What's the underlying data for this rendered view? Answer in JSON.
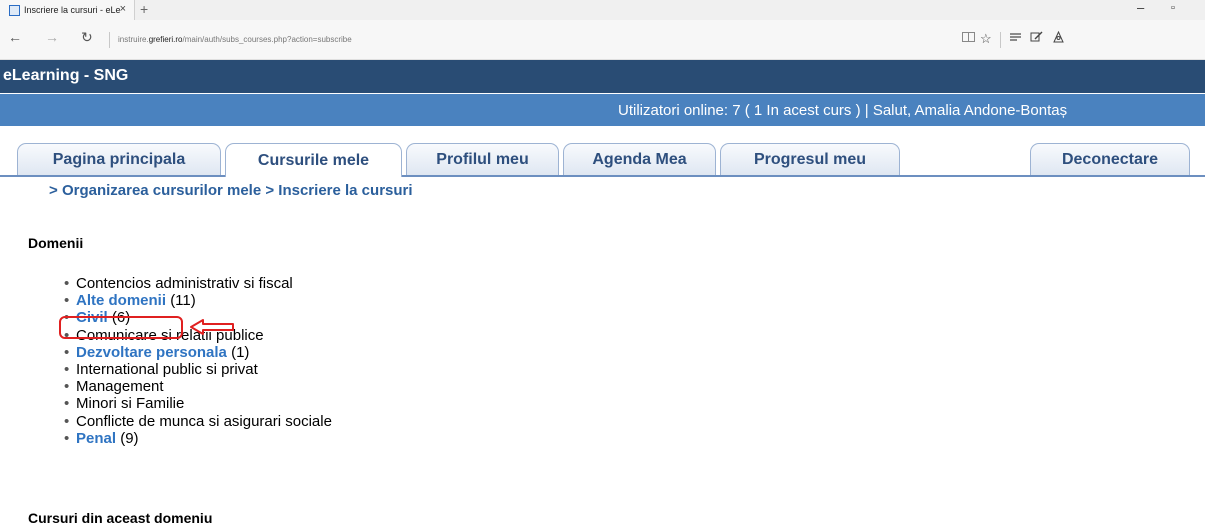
{
  "browser": {
    "tab_title": "Inscriere la cursuri - eLe",
    "tab_close": "×",
    "new_tab": "+",
    "address_prefix": "instruire.",
    "address_domain": "grefieri.ro",
    "address_path": "/main/auth/subs_courses.php?action=subscribe",
    "back": "←",
    "forward": "→",
    "refresh": "↻",
    "window_minimize": "–",
    "window_maximize": "▫",
    "icons": [
      "reading-view-icon",
      "favorites-icon",
      "hub-icon",
      "web-note-icon",
      "share-icon"
    ]
  },
  "site": {
    "title": "eLearning - SNG",
    "info_text": "Utilizatori online:  7  ( 1 In acest curs  ) | Salut, Amalia Andone-Bontaș"
  },
  "tabs": [
    {
      "label": "Pagina principala",
      "active": false
    },
    {
      "label": "Cursurile mele",
      "active": true
    },
    {
      "label": "Profilul meu",
      "active": false
    },
    {
      "label": "Agenda Mea",
      "active": false
    },
    {
      "label": "Progresul meu",
      "active": false
    },
    {
      "label": "Deconectare",
      "active": false
    }
  ],
  "breadcrumb": {
    "sep": ">",
    "items": [
      "Organizarea cursurilor mele",
      "Inscriere la cursuri"
    ]
  },
  "domains": {
    "heading": "Domenii",
    "items": [
      {
        "label": "Contencios administrativ si fiscal",
        "count": "",
        "link": false
      },
      {
        "label": "Alte domenii",
        "count": "(11)",
        "link": true
      },
      {
        "label": "Civil",
        "count": "(6)",
        "link": true
      },
      {
        "label": "Comunicare si relatii publice",
        "count": "",
        "link": false
      },
      {
        "label": "Dezvoltare personala",
        "count": "(1)",
        "link": true
      },
      {
        "label": "International public si privat",
        "count": "",
        "link": false
      },
      {
        "label": "Management",
        "count": "",
        "link": false
      },
      {
        "label": "Minori si Familie",
        "count": "",
        "link": false
      },
      {
        "label": "Conflicte de munca si asigurari sociale",
        "count": "",
        "link": false
      },
      {
        "label": "Penal",
        "count": "(9)",
        "link": true
      }
    ]
  },
  "courses": {
    "heading": "Cursuri din aceast domeniu"
  },
  "colors": {
    "header_dark": "#294c74",
    "info_bar": "#4a82bf",
    "link": "#2f74c2",
    "annotation_red": "#e02020"
  }
}
